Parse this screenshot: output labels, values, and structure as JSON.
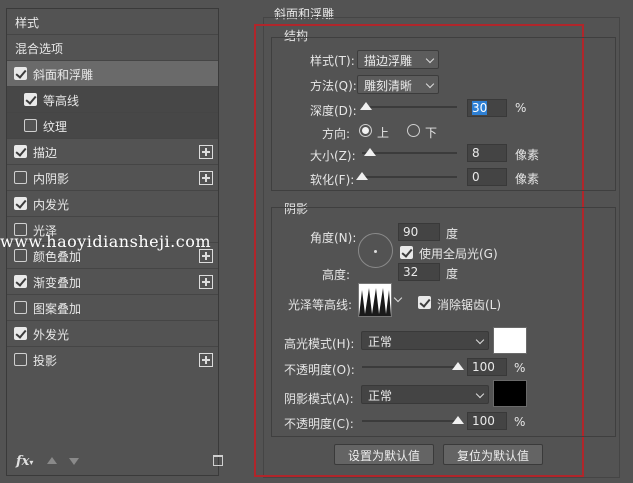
{
  "left_panel": {
    "items": [
      {
        "label": "样式"
      },
      {
        "label": "混合选项"
      },
      {
        "label": "斜面和浮雕",
        "checked": true
      },
      {
        "label": "等高线",
        "checked": true
      },
      {
        "label": "纹理",
        "checked": false
      },
      {
        "label": "描边",
        "checked": true
      },
      {
        "label": "内阴影",
        "checked": false
      },
      {
        "label": "内发光",
        "checked": true
      },
      {
        "label": "光泽",
        "checked": false
      },
      {
        "label": "颜色叠加",
        "checked": false
      },
      {
        "label": "渐变叠加",
        "checked": true
      },
      {
        "label": "图案叠加",
        "checked": false
      },
      {
        "label": "外发光",
        "checked": true
      },
      {
        "label": "投影",
        "checked": false
      }
    ],
    "fx_label": "fx"
  },
  "watermark": "www.haoyidiansheji.com",
  "panel_title": "斜面和浮雕",
  "structure": {
    "title": "结构",
    "style_label": "样式(T):",
    "style_value": "描边浮雕",
    "technique_label": "方法(Q):",
    "technique_value": "雕刻清晰",
    "depth_label": "深度(D):",
    "depth_value": "30",
    "depth_unit": "%",
    "direction_label": "方向:",
    "direction_up": "上",
    "direction_down": "下",
    "size_label": "大小(Z):",
    "size_value": "8",
    "size_unit": "像素",
    "soften_label": "软化(F):",
    "soften_value": "0",
    "soften_unit": "像素"
  },
  "shading": {
    "title": "阴影",
    "angle_label": "角度(N):",
    "angle_value": "90",
    "angle_unit": "度",
    "global_light_label": "使用全局光(G)",
    "altitude_label": "高度:",
    "altitude_value": "32",
    "altitude_unit": "度",
    "gloss_contour_label": "光泽等高线:",
    "anti_alias_label": "消除锯齿(L)",
    "highlight_mode_label": "高光模式(H):",
    "highlight_mode_value": "正常",
    "highlight_color": "#ffffff",
    "highlight_opacity_label": "不透明度(O):",
    "highlight_opacity_value": "100",
    "highlight_opacity_unit": "%",
    "shadow_mode_label": "阴影模式(A):",
    "shadow_mode_value": "正常",
    "shadow_color": "#000000",
    "shadow_opacity_label": "不透明度(C):",
    "shadow_opacity_value": "100",
    "shadow_opacity_unit": "%"
  },
  "buttons": {
    "make_default": "设置为默认值",
    "reset_default": "复位为默认值"
  },
  "colors": {
    "background": "#535353",
    "highlight_border": "#b0262b"
  }
}
